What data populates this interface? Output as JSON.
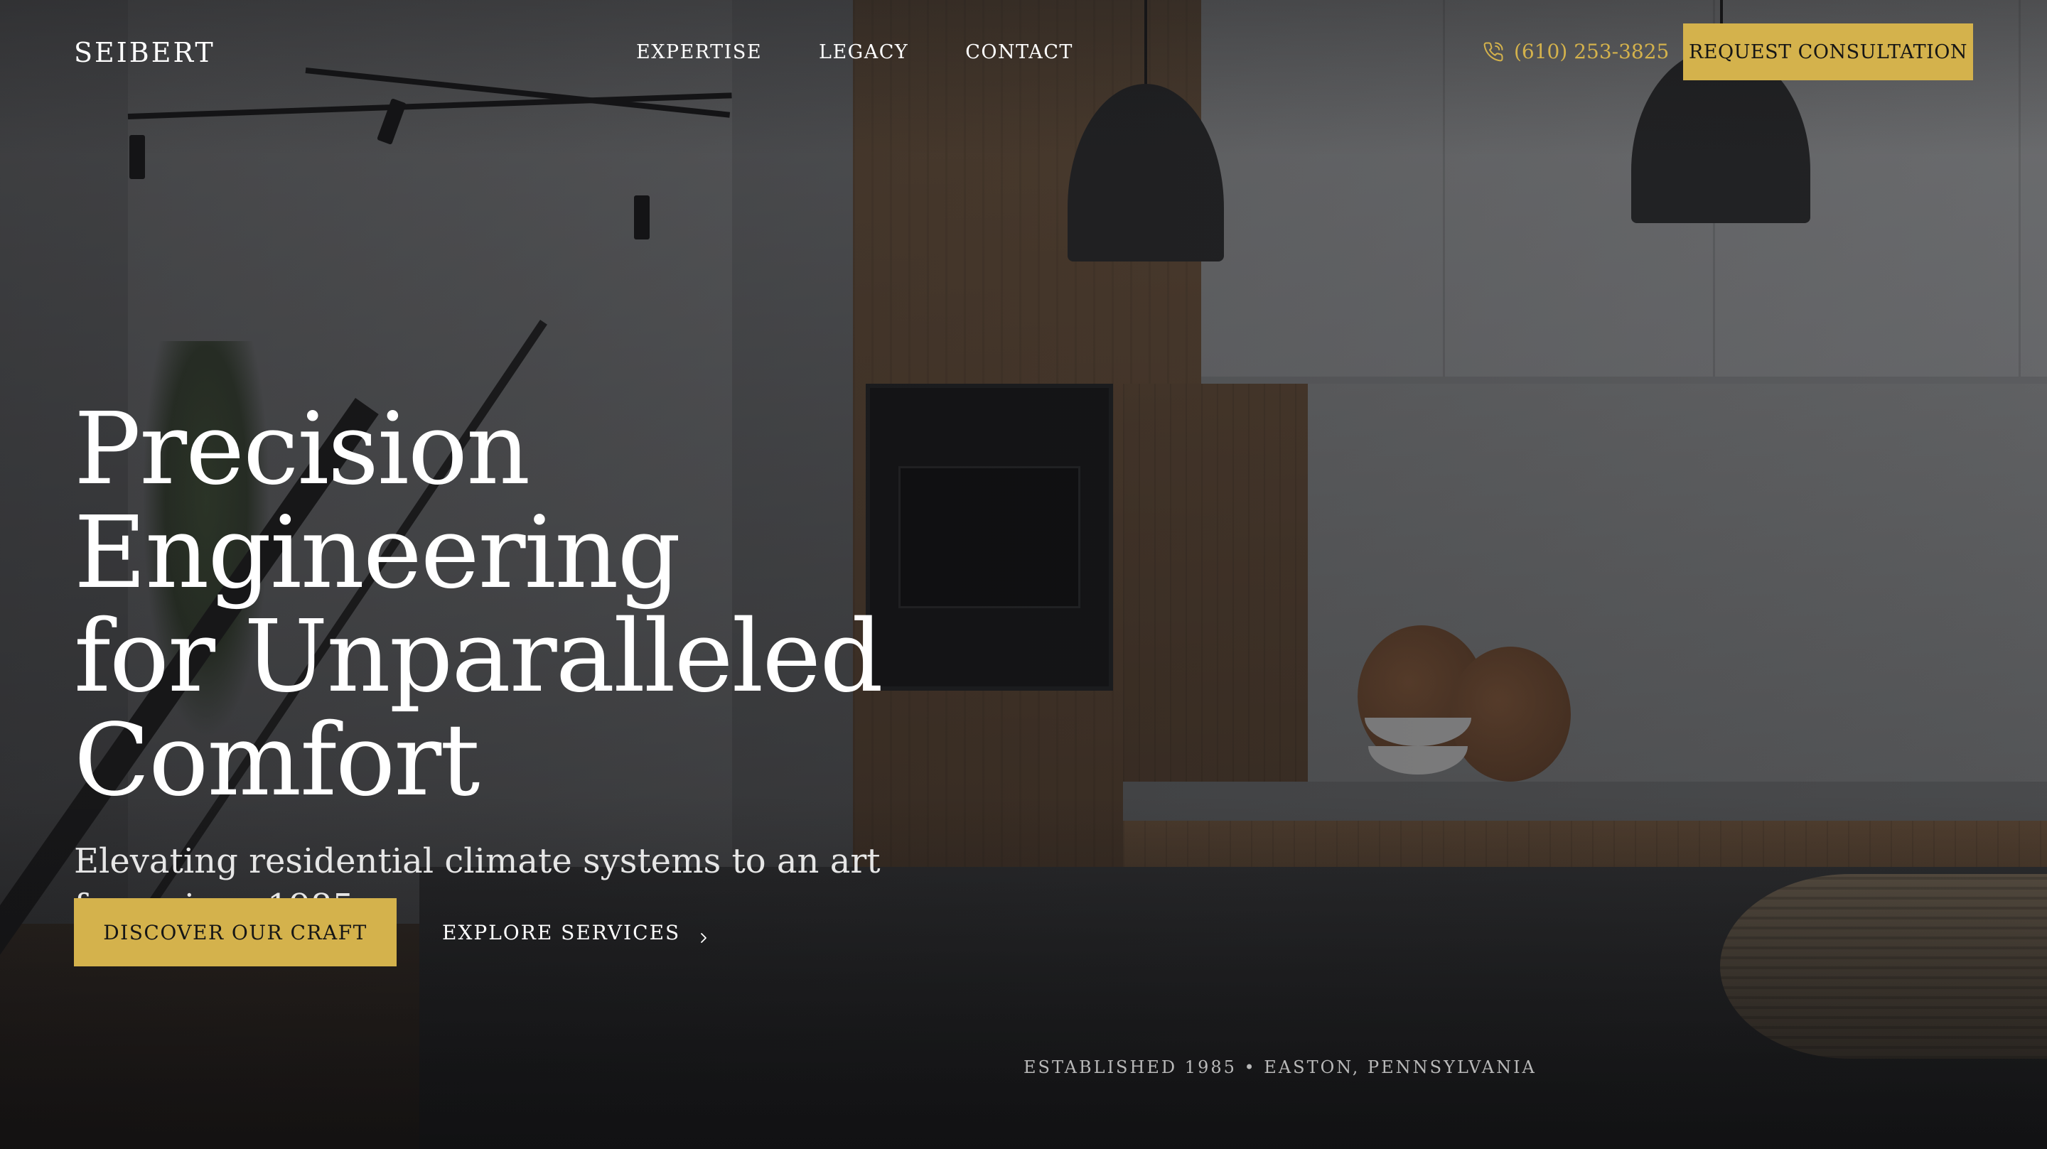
{
  "brand": {
    "name": "SEIBERT"
  },
  "nav": {
    "items": [
      {
        "label": "EXPERTISE"
      },
      {
        "label": "LEGACY"
      },
      {
        "label": "CONTACT"
      }
    ]
  },
  "header": {
    "phone": "(610) 253-3825",
    "phone_icon": "phone-icon",
    "cta_label": "REQUEST CONSULTATION"
  },
  "hero": {
    "title_lines": [
      "Precision Engineering",
      "for Unparalleled",
      "Comfort"
    ],
    "subtitle": "Elevating residential climate systems to an art form since 1985.",
    "primary_cta": "DISCOVER OUR CRAFT",
    "secondary_cta": "EXPLORE SERVICES",
    "secondary_icon": "chevron-right-icon"
  },
  "footer_note": "ESTABLISHED 1985 • EASTON, PENNSYLVANIA",
  "colors": {
    "accent": "#d4b24c",
    "text": "#ffffff",
    "muted": "#b9b9b9"
  }
}
